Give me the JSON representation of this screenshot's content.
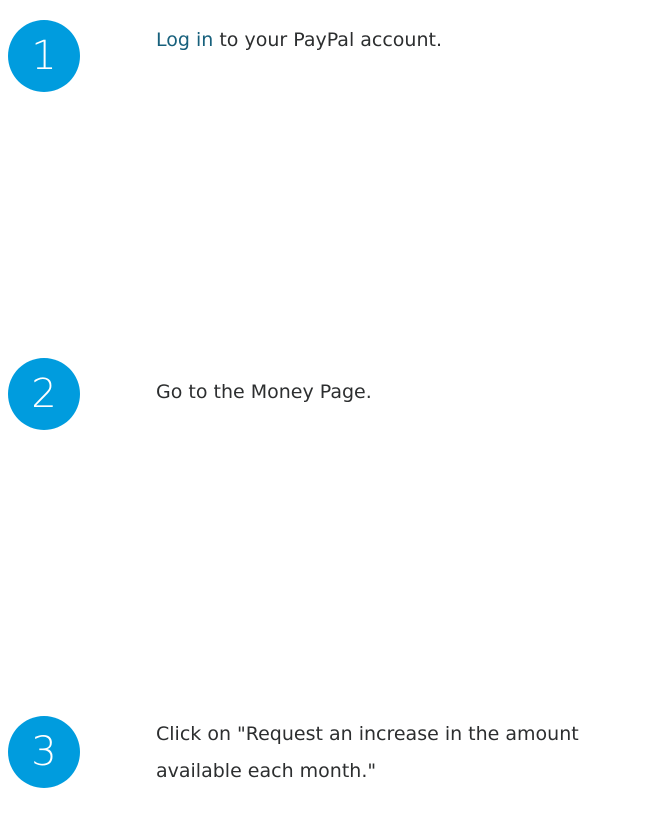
{
  "steps": [
    {
      "number": "1",
      "link_text": "Log in",
      "text": " to your PayPal account."
    },
    {
      "number": "2",
      "text": "Go to the Money Page."
    },
    {
      "number": "3",
      "text": "Click on \"Request an increase in the amount available each month.\""
    }
  ],
  "colors": {
    "badge": "#009cde",
    "link": "#17607c",
    "text": "#2c2e2f"
  }
}
